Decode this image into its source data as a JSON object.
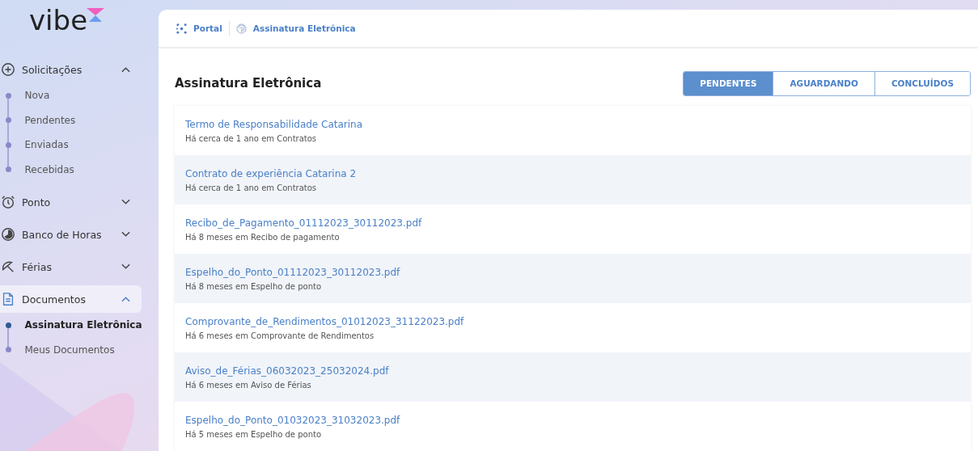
{
  "logo": {
    "text": "vibe"
  },
  "sidebar": {
    "groups": [
      {
        "label": "Solicitações",
        "expanded": true,
        "selected": false,
        "children": [
          {
            "label": "Nova",
            "selected": false
          },
          {
            "label": "Pendentes",
            "selected": false
          },
          {
            "label": "Enviadas",
            "selected": false
          },
          {
            "label": "Recebidas",
            "selected": false
          }
        ]
      },
      {
        "label": "Ponto",
        "expanded": false,
        "selected": false
      },
      {
        "label": "Banco de Horas",
        "expanded": false,
        "selected": false
      },
      {
        "label": "Férias",
        "expanded": false,
        "selected": false
      },
      {
        "label": "Documentos",
        "expanded": true,
        "selected": true,
        "children": [
          {
            "label": "Assinatura Eletrônica",
            "selected": true
          },
          {
            "label": "Meus Documentos",
            "selected": false
          }
        ]
      }
    ]
  },
  "breadcrumb": [
    {
      "label": "Portal"
    },
    {
      "label": "Assinatura Eletrônica"
    }
  ],
  "page_title": "Assinatura Eletrônica",
  "tabs": [
    {
      "label": "PENDENTES",
      "selected": true
    },
    {
      "label": "AGUARDANDO",
      "selected": false
    },
    {
      "label": "CONCLUÍDOS",
      "selected": false
    }
  ],
  "documents": [
    {
      "title": "Termo de Responsabilidade Catarina",
      "meta": "Há cerca de 1 ano em Contratos"
    },
    {
      "title": "Contrato de experiência Catarina 2",
      "meta": "Há cerca de 1 ano em Contratos"
    },
    {
      "title": "Recibo_de_Pagamento_01112023_30112023.pdf",
      "meta": "Há 8 meses em Recibo de pagamento"
    },
    {
      "title": "Espelho_do_Ponto_01112023_30112023.pdf",
      "meta": "Há 8 meses em Espelho de ponto"
    },
    {
      "title": "Comprovante_de_Rendimentos_01012023_31122023.pdf",
      "meta": "Há 6 meses em Comprovante de Rendimentos"
    },
    {
      "title": "Aviso_de_Férias_06032023_25032024.pdf",
      "meta": "Há 6 meses em Aviso de Férias"
    },
    {
      "title": "Espelho_do_Ponto_01032023_31032023.pdf",
      "meta": "Há 5 meses em Espelho de ponto"
    }
  ]
}
